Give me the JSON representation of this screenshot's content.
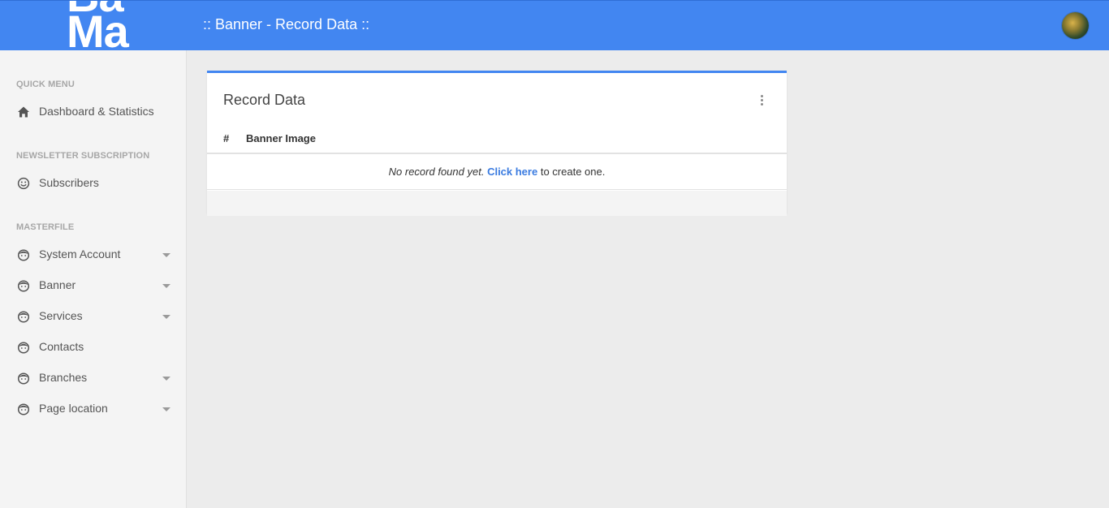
{
  "header": {
    "logo_text": "Ba\nMa",
    "title": ":: Banner - Record Data ::"
  },
  "sidebar": {
    "sections": [
      {
        "title": "QUICK MENU",
        "items": [
          {
            "label": "Dashboard & Statistics",
            "icon": "home-icon",
            "has_submenu": false
          }
        ]
      },
      {
        "title": "NEWSLETTER SUBSCRIPTION",
        "items": [
          {
            "label": "Subscribers",
            "icon": "smiley-icon",
            "has_submenu": false
          }
        ]
      },
      {
        "title": "MASTERFILE",
        "items": [
          {
            "label": "System Account",
            "icon": "face-icon",
            "has_submenu": true
          },
          {
            "label": "Banner",
            "icon": "face-icon",
            "has_submenu": true
          },
          {
            "label": "Services",
            "icon": "face-icon",
            "has_submenu": true
          },
          {
            "label": "Contacts",
            "icon": "face-icon",
            "has_submenu": false
          },
          {
            "label": "Branches",
            "icon": "face-icon",
            "has_submenu": true
          },
          {
            "label": "Page location",
            "icon": "face-icon",
            "has_submenu": true
          }
        ]
      }
    ]
  },
  "card": {
    "title": "Record Data",
    "columns": [
      "#",
      "Banner Image"
    ],
    "empty": {
      "message": "No record found yet.",
      "link_text": "Click here",
      "suffix": "to create one."
    }
  },
  "colors": {
    "brand": "#4286f1",
    "link": "#3a7be0",
    "sidebar_bg": "#f4f4f4",
    "page_bg": "#ececec"
  }
}
